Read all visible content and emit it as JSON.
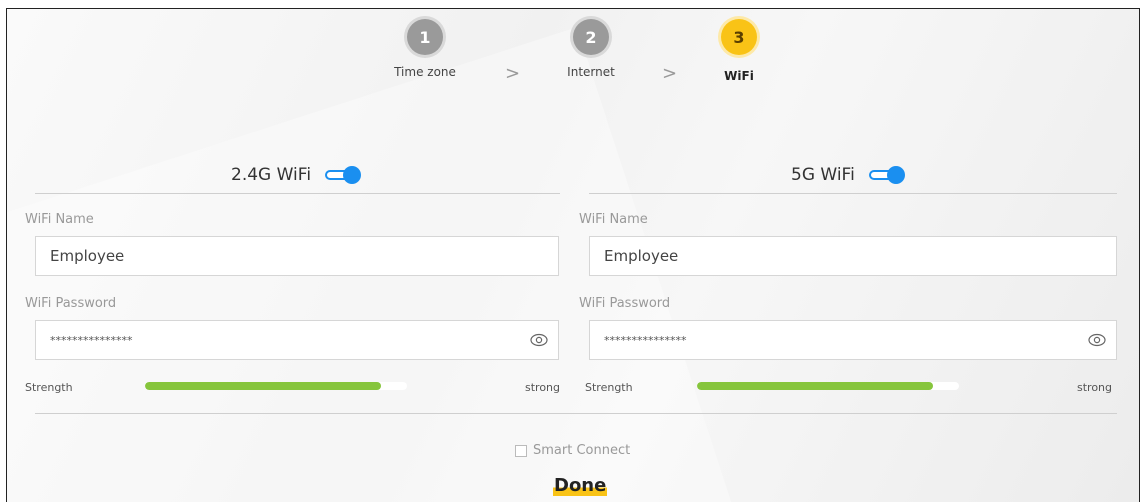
{
  "steps": [
    {
      "number": "1",
      "label": "Time zone"
    },
    {
      "number": "2",
      "label": "Internet"
    },
    {
      "number": "3",
      "label": "WiFi"
    }
  ],
  "separator": ">",
  "bands": {
    "left": {
      "title": "2.4G WiFi",
      "enabled": true,
      "name_label": "WiFi Name",
      "name_value": "Employee",
      "password_label": "WiFi Password",
      "password_value": "***************",
      "strength_label": "Strength",
      "strength_text": "strong",
      "strength_level": 0.9
    },
    "right": {
      "title": "5G WiFi",
      "enabled": true,
      "name_label": "WiFi Name",
      "name_value": "Employee",
      "password_label": "WiFi Password",
      "password_value": "***************",
      "strength_label": "Strength",
      "strength_text": "strong",
      "strength_level": 0.9
    }
  },
  "smart_connect_label": "Smart Connect",
  "done_label": "Done",
  "colors": {
    "accent": "#f9c316",
    "toggle": "#1a8ff0",
    "strength": "#86c53c",
    "step_inactive": "#9a9a9a"
  }
}
